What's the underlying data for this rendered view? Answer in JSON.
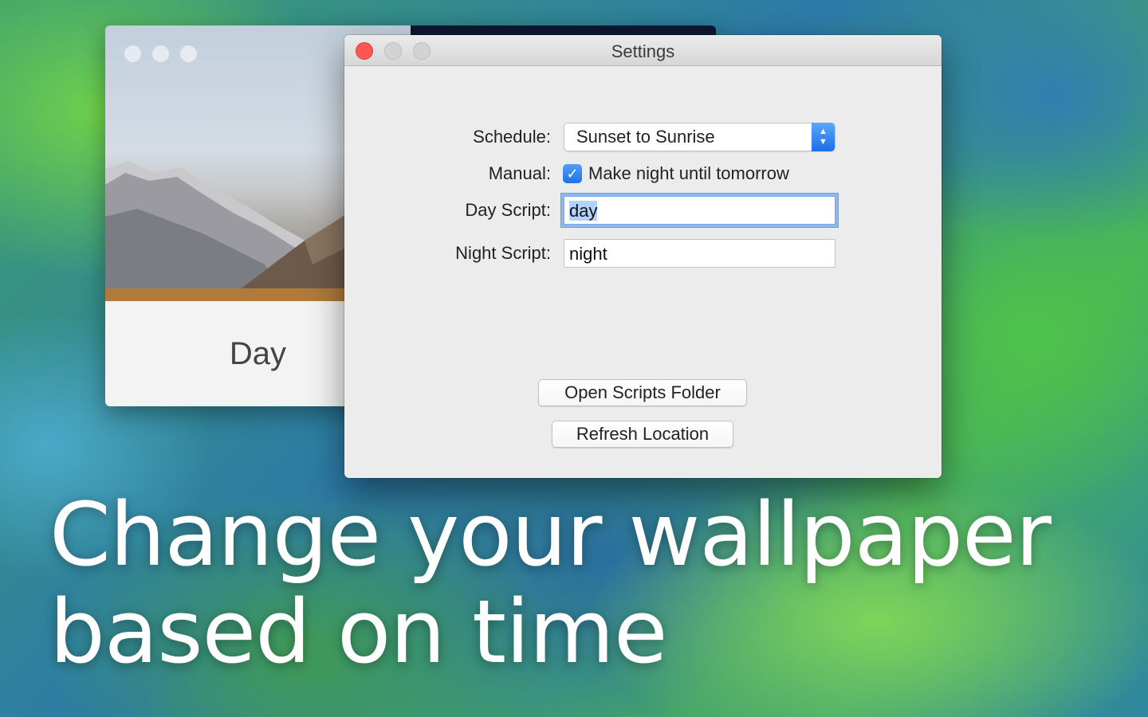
{
  "back_window": {
    "caption": "Day"
  },
  "settings": {
    "title": "Settings",
    "schedule_label": "Schedule:",
    "schedule_value": "Sunset to Sunrise",
    "manual_label": "Manual:",
    "manual_checkbox_label": "Make night until tomorrow",
    "manual_checked": true,
    "day_script_label": "Day Script:",
    "day_script_value": "day",
    "night_script_label": "Night Script:",
    "night_script_value": "night",
    "open_scripts_button": "Open Scripts Folder",
    "refresh_location_button": "Refresh Location"
  },
  "headline": {
    "line1": "Change your wallpaper",
    "line2": "based on time"
  },
  "colors": {
    "close": "#fc5753",
    "accent": "#1f72e6",
    "selection": "#b3d3fd"
  }
}
